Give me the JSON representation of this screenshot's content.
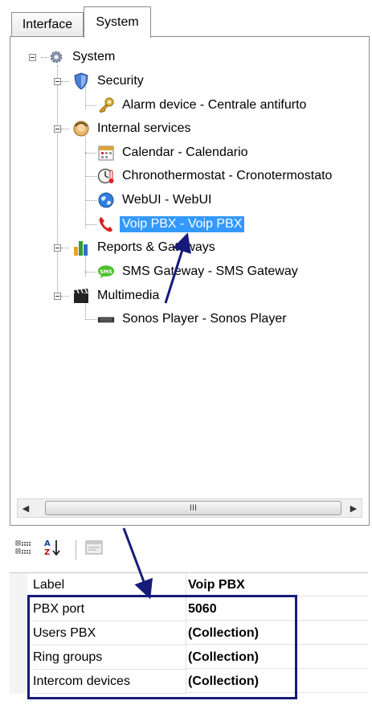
{
  "tabs": [
    {
      "label": "Interface",
      "active": false
    },
    {
      "label": "System",
      "active": true
    }
  ],
  "tree": {
    "root": {
      "label": "System",
      "icon": "gear-icon"
    },
    "groups": [
      {
        "label": "Security",
        "icon": "shield-icon",
        "children": [
          {
            "label": "Alarm device - Centrale antifurto",
            "icon": "key-icon"
          }
        ]
      },
      {
        "label": "Internal services",
        "icon": "head-icon",
        "children": [
          {
            "label": "Calendar - Calendario",
            "icon": "calendar-icon"
          },
          {
            "label": "Chronothermostat - Cronotermostato",
            "icon": "thermostat-icon"
          },
          {
            "label": "WebUI - WebUI",
            "icon": "globe-icon"
          },
          {
            "label": "Voip PBX - Voip PBX",
            "icon": "phone-icon",
            "selected": true
          }
        ]
      },
      {
        "label": "Reports & Gateways",
        "icon": "bar-chart-icon",
        "children": [
          {
            "label": "SMS Gateway - SMS Gateway",
            "icon": "sms-icon"
          }
        ]
      },
      {
        "label": "Multimedia",
        "icon": "clapper-icon",
        "children": [
          {
            "label": "Sonos Player - Sonos Player",
            "icon": "speaker-icon"
          }
        ]
      }
    ]
  },
  "scrollbar": {
    "thumb_grip": "III",
    "left_arrow": "◀",
    "right_arrow": "▶"
  },
  "properties_toolbar": {
    "categorized": "categorized-icon",
    "alphabetical": "sort-az-icon",
    "property_pages": "property-pages-icon"
  },
  "properties": [
    {
      "key": "Label",
      "value": "Voip PBX"
    },
    {
      "key": "PBX port",
      "value": "5060"
    },
    {
      "key": "Users PBX",
      "value": "(Collection)"
    },
    {
      "key": "Ring groups",
      "value": "(Collection)"
    },
    {
      "key": "Intercom devices",
      "value": "(Collection)"
    }
  ],
  "colors": {
    "selection": "#3399ff",
    "annotation": "#161b7a"
  }
}
